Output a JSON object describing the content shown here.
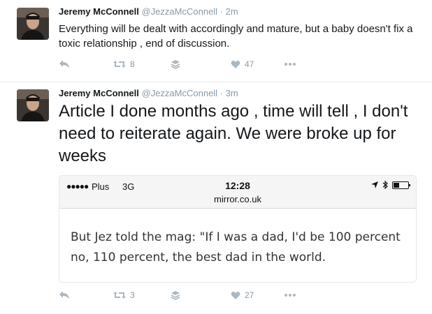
{
  "tweets": [
    {
      "name": "Jeremy McConnell",
      "handle": "@JezzaMcConnell",
      "separator": "·",
      "time": "2m",
      "text": "Everything will be dealt with accordingly and mature, but a baby doesn't fix a toxic relationship , end of discussion.",
      "retweets": "8",
      "likes": "47"
    },
    {
      "name": "Jeremy McConnell",
      "handle": "@JezzaMcConnell",
      "separator": "·",
      "time": "3m",
      "text": "Article I done months ago , time will tell , I don't need to reiterate again. We were broke up for weeks",
      "retweets": "3",
      "likes": "27",
      "embed": {
        "signal": "●●●●●",
        "carrier": "Plus",
        "network": "3G",
        "clock": "12:28",
        "url": "mirror.co.uk",
        "article_text": "But Jez told the mag: \"If I was a dad, I'd be 100 percent no, 110 percent, the best dad in the world."
      }
    }
  ],
  "icons": {
    "reply": "reply-icon",
    "retweet": "retweet-icon",
    "layers": "layers-icon",
    "like": "heart-icon",
    "more": "more-icon"
  },
  "colors": {
    "text": "#14171a",
    "secondary": "#8899a6",
    "icon": "#aab8c2",
    "divider": "#e6ecf0"
  }
}
